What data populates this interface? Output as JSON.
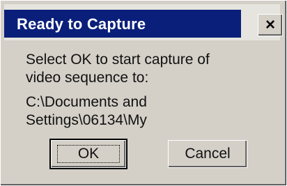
{
  "dialog": {
    "title": "Ready to Capture",
    "close_glyph": "×",
    "message_lines": [
      "Select OK to start capture of",
      "video sequence to:",
      "C:\\Documents and",
      "Settings\\06134\\My"
    ],
    "buttons": {
      "ok_label": "OK",
      "cancel_label": "Cancel"
    }
  },
  "colors": {
    "title_bar": "#0a1f7a",
    "face": "#d4d0c8"
  }
}
